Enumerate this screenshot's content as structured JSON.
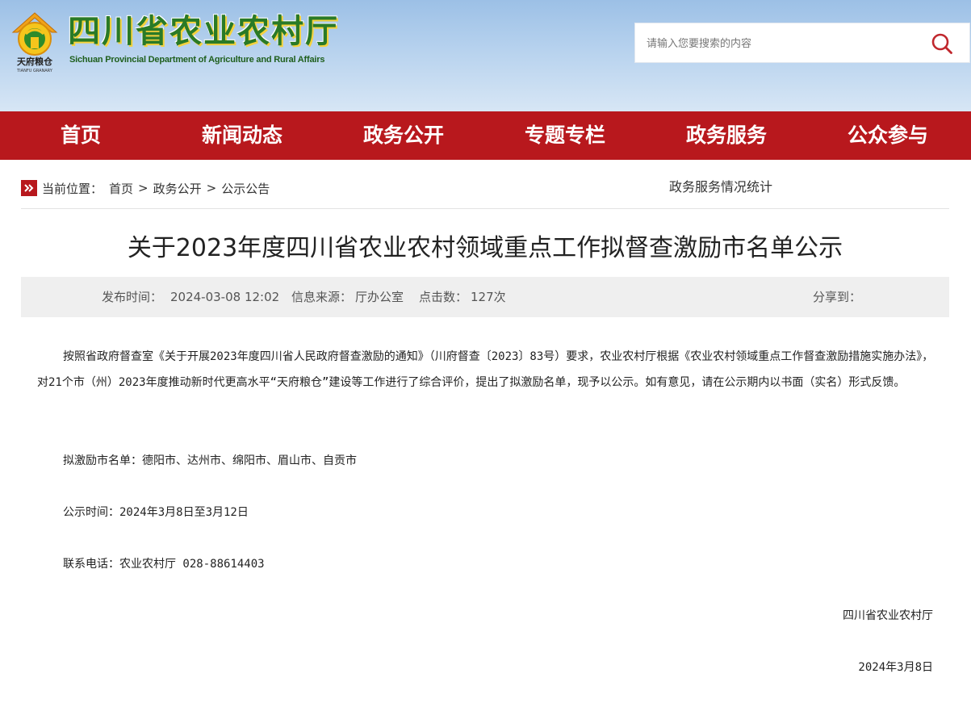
{
  "header": {
    "seal_text": "天府粮仓",
    "seal_subtext": "TIANFU GRANARY",
    "title": "四川省农业农村厅",
    "subtitle": "Sichuan Provincial Department of Agriculture and Rural Affairs",
    "search_placeholder": "请输入您要搜索的内容",
    "search_icon": "search-icon"
  },
  "nav": {
    "items": [
      "首页",
      "新闻动态",
      "政务公开",
      "专题专栏",
      "政务服务",
      "公众参与"
    ]
  },
  "breadcrumb": {
    "label": "当前位置：",
    "items": [
      "首页",
      "政务公开",
      "公示公告"
    ],
    "separator": ">"
  },
  "side_link": "政务服务情况统计",
  "article": {
    "title": "关于2023年度四川省农业农村领域重点工作拟督查激励市名单公示",
    "meta": {
      "publish_label": "发布时间：",
      "publish_time": "2024-03-08 12:02",
      "source_label": "信息来源：",
      "source": "厅办公室",
      "clicks_label": "点击数：",
      "clicks": "127次",
      "share_label": "分享到："
    },
    "body": "按照省政府督查室《关于开展2023年度四川省人民政府督查激励的通知》（川府督查〔2023〕83号）要求，农业农村厅根据《农业农村领域重点工作督查激励措施实施办法》，对21个市（州）2023年度推动新时代更高水平“天府粮仓”建设等工作进行了综合评价，提出了拟激励名单，现予以公示。如有意见，请在公示期内以书面（实名）形式反馈。",
    "list_line": "拟激励市名单：德阳市、达州市、绵阳市、眉山市、自贡市",
    "period_line": "公示时间：2024年3月8日至3月12日",
    "contact_line": "联系电话：农业农村厅 028-88614403",
    "signature": "四川省农业农村厅",
    "date": "2024年3月8日"
  },
  "colors": {
    "nav_red": "#b8181d",
    "logo_green": "#2a7a27",
    "logo_yellow": "#f5d23c"
  }
}
